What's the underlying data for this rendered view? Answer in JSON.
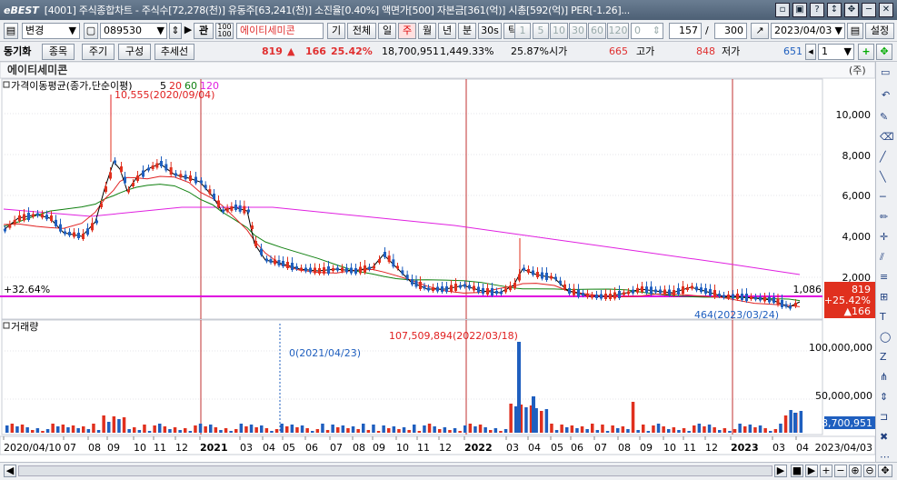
{
  "titlebar": {
    "logo": "eBEST",
    "text": "[4001] 주식종합차트 - 주식수[72,278(천)] 유동주[63,241(천)] 소진율[0.40%] 액면가[500] 자본금[361(억)] 시총[592(억)] PER[-1.26]..."
  },
  "toolbar1": {
    "change": "변경",
    "code": "089530",
    "gwan": "관",
    "name": "에이티세미콘",
    "periods": [
      "기",
      "전체",
      "일",
      "주",
      "월",
      "년",
      "분",
      "30s",
      "틱"
    ],
    "selected_period": "주",
    "intervals": [
      "1",
      "5",
      "10",
      "30",
      "60",
      "120"
    ],
    "zero": "0",
    "count_shown": "157",
    "slash": "/",
    "count_total": "300",
    "date": "2023/04/03",
    "settings": "설정"
  },
  "toolbar2": {
    "sync": "동기화",
    "stock": "종목",
    "period": "주기",
    "config": "구성",
    "trendline": "추세선",
    "price": "819",
    "change_arrow": "▲",
    "change": "166",
    "change_pct": "25.42%",
    "volume": "18,700,951",
    "vol_pct": "1,449.33%",
    "turnover": "25.87%",
    "open_label": "시가",
    "open": "665",
    "high_label": "고가",
    "high": "848",
    "low_label": "저가",
    "low": "651",
    "page": "1"
  },
  "chart": {
    "stock_name": "에이티세미콘",
    "unit": "(주)",
    "price_panel_title": "가격이동평균(종가,단순이평)",
    "ma_labels": [
      {
        "text": "5",
        "color": "#000000"
      },
      {
        "text": "20",
        "color": "#e02020"
      },
      {
        "text": "60",
        "color": "#108010"
      },
      {
        "text": "120",
        "color": "#e020e0"
      }
    ],
    "high_annotation": "10,555(2020/09/04)",
    "low_annotation": "464(2023/03/24)",
    "pct_label": "+32.64%",
    "price_axis": [
      "10,000",
      "8,000",
      "6,000",
      "4,000",
      "2,000"
    ],
    "last_price_box": [
      "819",
      "+25.42%",
      "▲166"
    ],
    "line_value": "1,086",
    "volume_title": "거래량",
    "vol_annotation_max": "107,509,894(2022/03/18)",
    "vol_annotation_zero": "0(2021/04/23)",
    "volume_axis": [
      "100,000,000",
      "50,000,000"
    ],
    "last_volume_box": "8,700,951",
    "date_axis": [
      "2020/04/10",
      "07",
      "08",
      "09",
      "10",
      "11",
      "12",
      "2021",
      "03",
      "04",
      "05",
      "06",
      "07",
      "08",
      "09",
      "10",
      "11",
      "12",
      "2022",
      "03",
      "04",
      "05",
      "06",
      "07",
      "08",
      "09",
      "10",
      "11",
      "12",
      "2023",
      "03",
      "04"
    ],
    "date_axis_end": "2023/04/03"
  },
  "colors": {
    "up": "#e0301e",
    "down": "#1f5fbf",
    "ma5": "#000000",
    "ma20": "#e02020",
    "ma60": "#108010",
    "ma120": "#e020e0",
    "highlight_line": "#e000e0",
    "year_separator": "#c03030"
  },
  "icons": [
    "chart-type-icon",
    "search-icon",
    "up-down-arrows-icon",
    "play-icon",
    "list-icon",
    "line-tool-icon",
    "zoom-in-icon",
    "zoom-out-icon"
  ]
}
